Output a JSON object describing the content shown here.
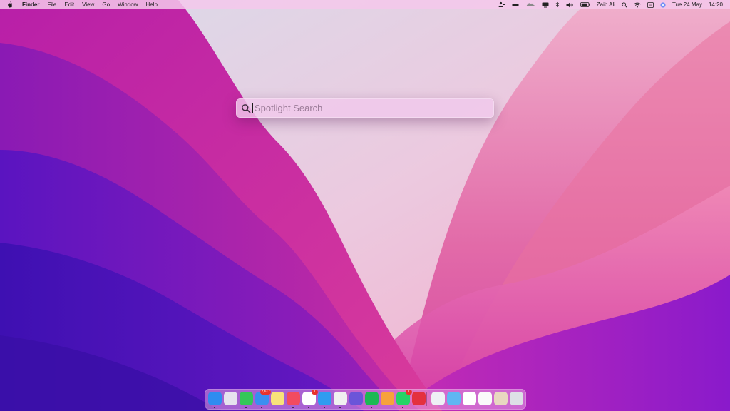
{
  "menubar": {
    "apple_icon": "apple-logo-icon",
    "app_name": "Finder",
    "menus": [
      "File",
      "Edit",
      "View",
      "Go",
      "Window",
      "Help"
    ],
    "status_icons": [
      "user-switch-icon",
      "speed-icon",
      "cloud-icon",
      "display-icon",
      "bluetooth-icon",
      "volume-icon",
      "battery-icon"
    ],
    "user_name": "Zaib Ali",
    "date": "Tue 24 May",
    "time": "14:20"
  },
  "spotlight": {
    "placeholder": "Spotlight Search",
    "value": ""
  },
  "dock": {
    "apps": [
      {
        "name": "Finder",
        "icon": "finder-icon",
        "color": "#2f8cf0"
      },
      {
        "name": "Launchpad",
        "icon": "launchpad-icon",
        "color": "#e6e2ee"
      },
      {
        "name": "Messages",
        "icon": "messages-icon",
        "color": "#34c759"
      },
      {
        "name": "Mail",
        "icon": "mail-icon",
        "color": "#3a8ef0",
        "badge": "2,617"
      },
      {
        "name": "Notes",
        "icon": "notes-icon",
        "color": "#f8e27a"
      },
      {
        "name": "Music",
        "icon": "music-icon",
        "color": "#f24b5f"
      },
      {
        "name": "Reminders",
        "icon": "reminders-icon",
        "color": "#ffffff",
        "badge": "1"
      },
      {
        "name": "Safari",
        "icon": "safari-icon",
        "color": "#2f9cf0"
      },
      {
        "name": "Pixelmator",
        "icon": "pixelmator-icon",
        "color": "#f0f0f0"
      },
      {
        "name": "Affinity",
        "icon": "affinity-icon",
        "color": "#6b55d9"
      },
      {
        "name": "Spotify",
        "icon": "spotify-icon",
        "color": "#1db954"
      },
      {
        "name": "Pages",
        "icon": "pages-icon",
        "color": "#f7a23b"
      },
      {
        "name": "WhatsApp",
        "icon": "whatsapp-icon",
        "color": "#25d366",
        "badge": "1"
      },
      {
        "name": "Speeko",
        "icon": "speeko-icon",
        "color": "#e4313f"
      }
    ],
    "folders": [
      {
        "name": "Documents",
        "icon": "folder-icon",
        "color": "#eef0f5"
      },
      {
        "name": "Downloads",
        "icon": "folder-icon",
        "color": "#5fb6f2"
      },
      {
        "name": "Screenshot",
        "icon": "screenshot-icon",
        "color": "#ffffff"
      },
      {
        "name": "Document Preview",
        "icon": "document-icon",
        "color": "#fafafa"
      },
      {
        "name": "Photo Stack",
        "icon": "photos-icon",
        "color": "#e8d7c0"
      },
      {
        "name": "Trash",
        "icon": "trash-icon",
        "color": "#dde0e6"
      }
    ]
  }
}
